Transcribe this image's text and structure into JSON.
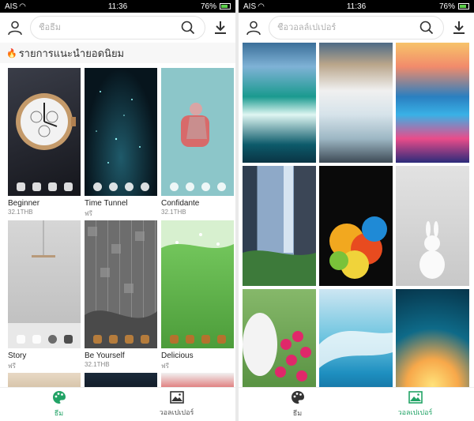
{
  "status_left": {
    "carrier": "AIS",
    "time": "11:36",
    "battery": "76%"
  },
  "status_right": {
    "carrier": "AIS",
    "time": "11:36",
    "battery": "76%"
  },
  "themes_screen": {
    "search_placeholder": "ชื่อธีม",
    "section_title": "รายการแนะนำยอดนิยม",
    "themes": [
      {
        "name": "Beginner",
        "price": "32.1THB"
      },
      {
        "name": "Time Tunnel",
        "price": "ฟรี"
      },
      {
        "name": "Confidante",
        "price": "32.1THB"
      },
      {
        "name": "Story",
        "price": "ฟรี"
      },
      {
        "name": "Be Yourself",
        "price": "32.1THB"
      },
      {
        "name": "Delicious",
        "price": "ฟรี"
      }
    ],
    "nav": [
      {
        "label": "ธีม",
        "active": true,
        "icon": "palette-icon"
      },
      {
        "label": "วอลเปเปอร์",
        "active": false,
        "icon": "image-icon"
      }
    ]
  },
  "wallpaper_screen": {
    "search_placeholder": "ชื่อวอลล์เปเปอร์",
    "wallpapers": [
      "waterfall-teal",
      "waterfall-sunset",
      "neon-city",
      "cliff-waterfall",
      "color-powder",
      "white-rabbit",
      "rabbit-flowers",
      "ocean-wave",
      "wave-sunset"
    ],
    "nav": [
      {
        "label": "ธีม",
        "active": false,
        "icon": "palette-icon"
      },
      {
        "label": "วอลเปเปอร์",
        "active": true,
        "icon": "image-icon"
      }
    ]
  },
  "colors": {
    "accent": "#22a366",
    "fire": "#ff6a2b"
  }
}
